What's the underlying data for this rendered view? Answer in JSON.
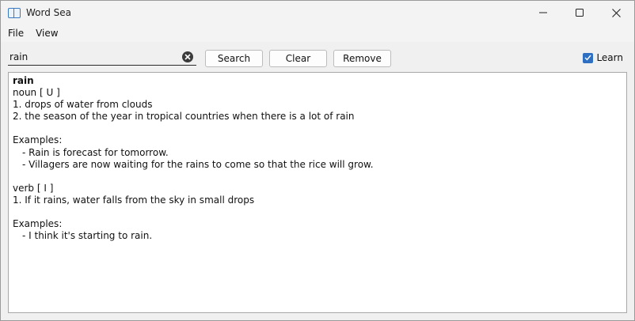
{
  "window": {
    "title": "Word Sea",
    "app_icon": "open-book-icon",
    "controls": [
      "minimize-icon",
      "maximize-icon",
      "close-icon"
    ]
  },
  "menu": {
    "items": [
      "File",
      "View"
    ]
  },
  "toolbar": {
    "search_value": "rain",
    "search_placeholder": "",
    "search_label": "Search",
    "clear_label": "Clear",
    "remove_label": "Remove",
    "learn_label": "Learn",
    "learn_checked": true
  },
  "entry": {
    "word": "rain",
    "senses": [
      {
        "pos": "noun [ U ]",
        "definitions": [
          "1. drops of water from clouds",
          "2. the season of the year in tropical countries when there is a lot of rain"
        ],
        "examples_label": "Examples:",
        "examples": [
          "- Rain is forecast for tomorrow.",
          "- Villagers are now waiting for the rains to come so that the rice will grow."
        ]
      },
      {
        "pos": "verb [ I ]",
        "definitions": [
          "1. If it rains, water falls from the sky in small drops"
        ],
        "examples_label": "Examples:",
        "examples": [
          "- I think it's starting to rain."
        ]
      }
    ]
  },
  "colors": {
    "accent": "#2f6fc2",
    "window_bg": "#f0f0f0",
    "content_bg": "#ffffff"
  }
}
